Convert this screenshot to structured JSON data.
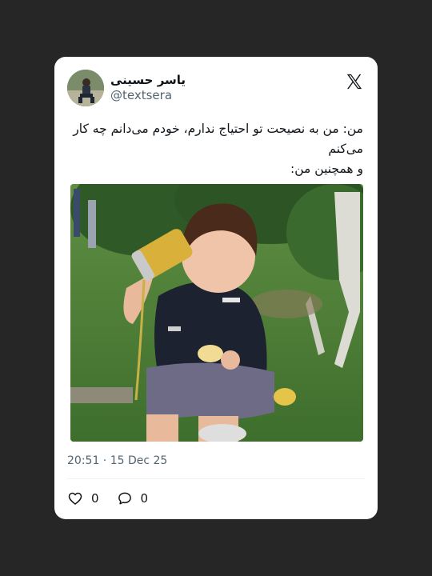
{
  "user": {
    "display_name": "یاسر حسینی",
    "handle": "@textsera"
  },
  "tweet": {
    "lines": [
      "من: من به نصیحت تو احتیاج ندارم، خودم می‌دانم چه کار",
      "می‌کنم",
      "و همچنین من:"
    ],
    "timestamp": "20:51 · 15 Dec 25"
  },
  "actions": {
    "likes": "0",
    "replies": "0"
  },
  "icons": {
    "logo": "x-logo-icon",
    "like": "heart-icon",
    "reply": "comment-icon"
  },
  "colors": {
    "background": "#262626",
    "card": "#ffffff",
    "text": "#0f1419",
    "secondary": "#536471"
  }
}
